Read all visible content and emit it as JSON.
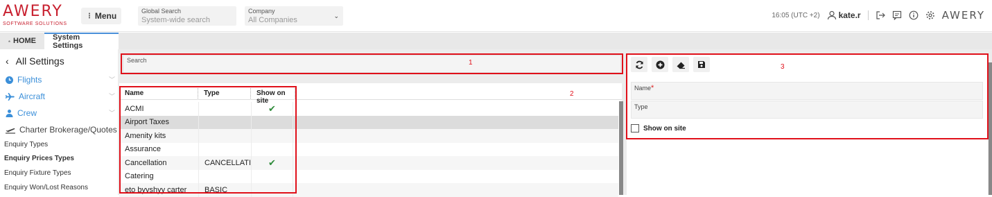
{
  "brand": {
    "logo_text": "AWERY",
    "logo_sub": "SOFTWARE SOLUTIONS",
    "color": "#c8202f"
  },
  "topbar": {
    "menu_label": "Menu",
    "global_search": {
      "label": "Global Search",
      "placeholder": "System-wide search"
    },
    "company": {
      "label": "Company",
      "value": "All Companies"
    },
    "time": "16:05 (UTC +2)",
    "user": "kate.r",
    "right_brand": "AWERY",
    "icons": [
      "user-icon",
      "logout-icon",
      "chat-icon",
      "info-icon",
      "gear-icon"
    ]
  },
  "tabs": [
    {
      "label": "HOME",
      "icon": "home-icon"
    },
    {
      "label": "System Settings",
      "active": true
    }
  ],
  "sidebar": {
    "title": "All Settings",
    "items": [
      {
        "label": "Flights",
        "icon": "clock-icon"
      },
      {
        "label": "Aircraft",
        "icon": "plane-icon"
      },
      {
        "label": "Crew",
        "icon": "crew-icon"
      },
      {
        "label": "Charter Brokerage/Quotes",
        "icon": "departure-icon"
      }
    ],
    "subitems": [
      {
        "label": "Enquiry Types",
        "bold": false
      },
      {
        "label": "Enquiry Prices Types",
        "bold": true
      },
      {
        "label": "Enquiry Fixture Types",
        "bold": false
      },
      {
        "label": "Enquiry Won/Lost Reasons",
        "bold": false
      }
    ]
  },
  "search": {
    "label": "Search"
  },
  "grid": {
    "columns": [
      "Name",
      "Type",
      "Show on site"
    ],
    "rows": [
      {
        "name": "ACMI",
        "type": "",
        "show": true
      },
      {
        "name": "Airport Taxes",
        "type": "",
        "show": false
      },
      {
        "name": "Amenity kits",
        "type": "",
        "show": false
      },
      {
        "name": "Assurance",
        "type": "",
        "show": false
      },
      {
        "name": "Cancellation",
        "type": "CANCELLATI...",
        "show": true
      },
      {
        "name": "Catering",
        "type": "",
        "show": false
      },
      {
        "name": "eto byvshyy carter",
        "type": "BASIC",
        "show": false
      }
    ]
  },
  "form": {
    "toolbar": [
      "refresh-icon",
      "add-icon",
      "eraser-icon",
      "save-icon"
    ],
    "name_label": "Name",
    "name_required": "*",
    "type_label": "Type",
    "show_label": "Show on site"
  },
  "annotations": {
    "one": "1",
    "two": "2",
    "three": "3",
    "color": "#e0101a"
  }
}
